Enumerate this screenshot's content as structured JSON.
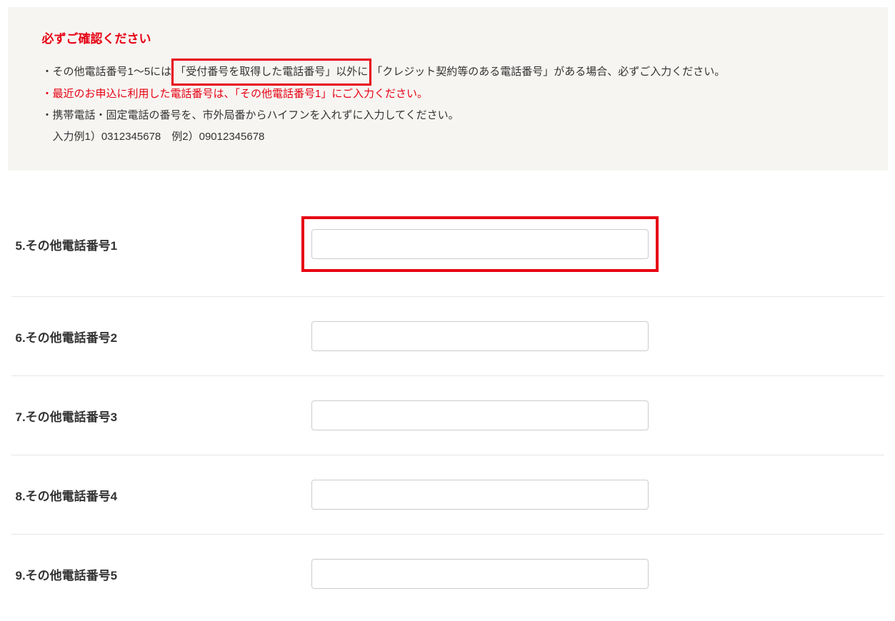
{
  "notice": {
    "title": "必ずご確認ください",
    "item1_prefix": "・その他電話番号1～5には",
    "item1_boxed": "「受付番号を取得した電話番号」以外に",
    "item1_suffix": "「クレジット契約等のある電話番号」がある場合、必ずご入力ください。",
    "item2": "・最近のお申込に利用した電話番号は、「その他電話番号1」にご入力ください。",
    "item3": "・携帯電話・固定電話の番号を、市外局番からハイフンを入れずに入力してください。",
    "item4": "　入力例1）0312345678　例2）09012345678"
  },
  "fields": {
    "f5": {
      "label": "5.その他電話番号1",
      "value": ""
    },
    "f6": {
      "label": "6.その他電話番号2",
      "value": ""
    },
    "f7": {
      "label": "7.その他電話番号3",
      "value": ""
    },
    "f8": {
      "label": "8.その他電話番号4",
      "value": ""
    },
    "f9": {
      "label": "9.その他電話番号5",
      "value": ""
    }
  }
}
